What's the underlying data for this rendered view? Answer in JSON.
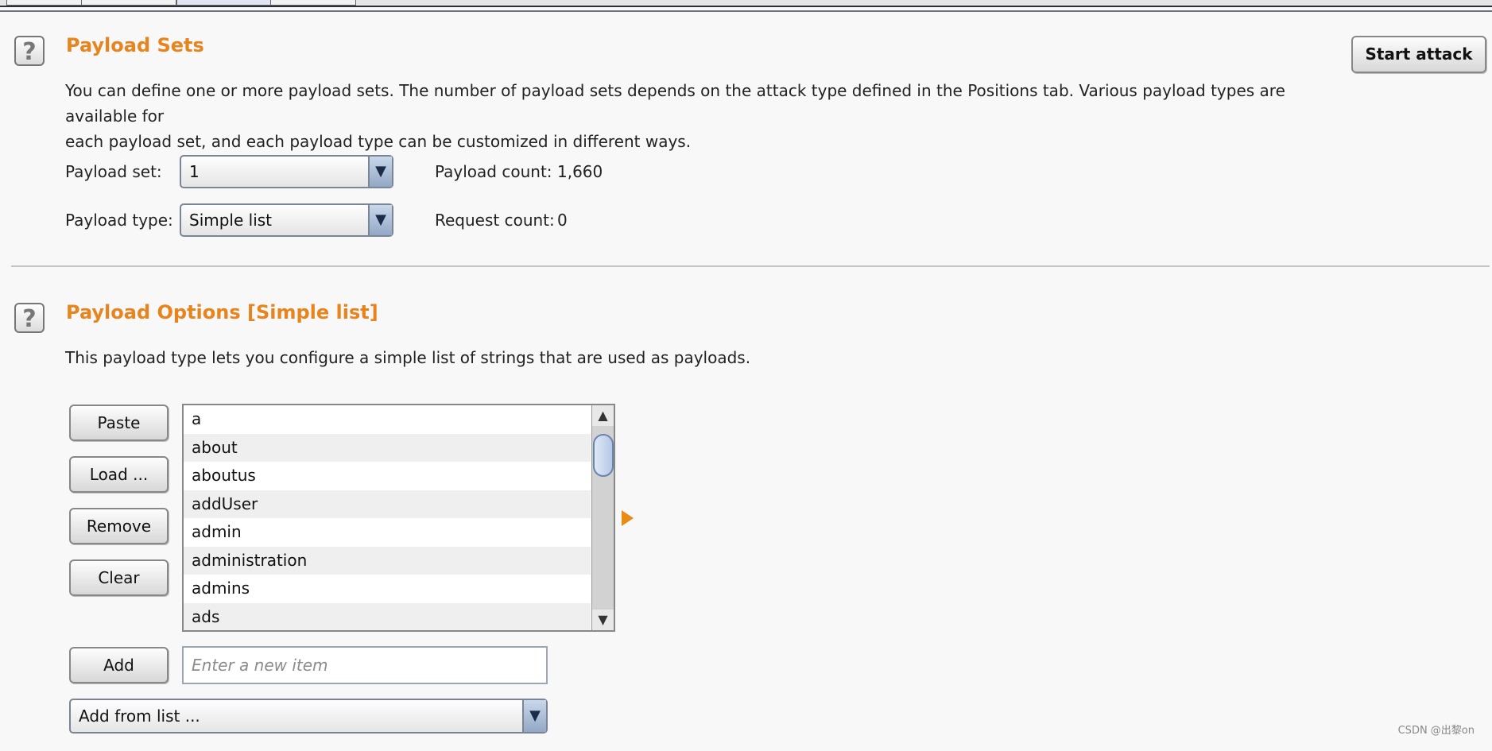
{
  "payload_sets": {
    "title": "Payload Sets",
    "description_line1": "You can define one or more payload sets. The number of payload sets depends on the attack type defined in the Positions tab. Various payload types are available for",
    "description_line2": "each payload set, and each payload type can be customized in different ways.",
    "set_label": "Payload set:",
    "set_value": "1",
    "type_label": "Payload type:",
    "type_value": "Simple list",
    "count_label": "Payload count:",
    "count_value": "1,660",
    "request_label": "Request count:",
    "request_value": "0"
  },
  "start_attack_label": "Start attack",
  "help_icon_glyph": "?",
  "payload_options": {
    "title": "Payload Options [Simple list]",
    "description": "This payload type lets you configure a simple list of strings that are used as payloads.",
    "buttons": {
      "paste": "Paste",
      "load": "Load ...",
      "remove": "Remove",
      "clear": "Clear",
      "add": "Add"
    },
    "items": [
      "a",
      "about",
      "aboutus",
      "addUser",
      "admin",
      "administration",
      "admins",
      "ads"
    ],
    "new_item_placeholder": "Enter a new item",
    "add_from_list": "Add from list ..."
  },
  "watermark": "CSDN @出黎on",
  "colors": {
    "accent": "#e8841e"
  },
  "icons": {
    "help": "question-mark-icon",
    "dropdown": "down-triangle-icon",
    "pointer": "orange-right-arrow-icon"
  }
}
